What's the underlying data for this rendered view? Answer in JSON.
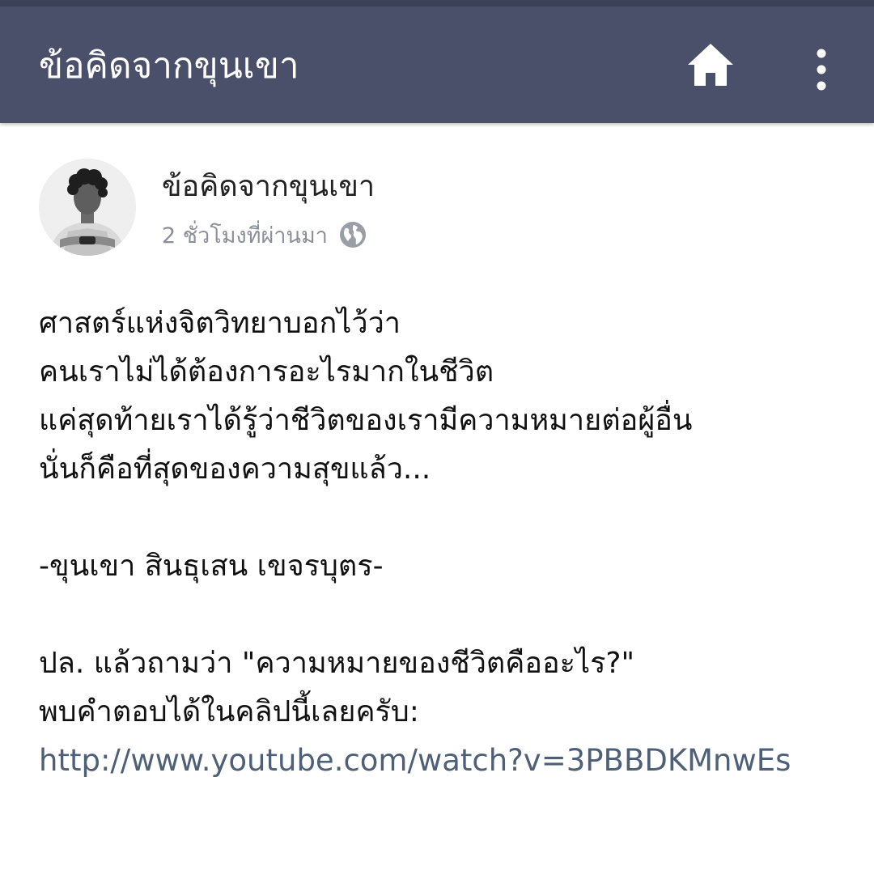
{
  "app_bar": {
    "title": "ข้อคิดจากขุนเขา",
    "home_icon": "home-icon",
    "more_icon": "more-vertical-icon",
    "background_color": "#4a5069"
  },
  "post": {
    "author": "ข้อคิดจากขุนเขา",
    "time": "2 ชั่วโมงที่ผ่านมา",
    "privacy_icon": "globe-icon",
    "lines": [
      "ศาสตร์แห่งจิตวิทยาบอกไว้ว่า",
      "คนเราไม่ได้ต้องการอะไรมากในชีวิต",
      "แค่สุดท้ายเราได้รู้ว่าชีวิตของเรามีความหมายต่อผู้อื่น",
      "นั่นก็คือที่สุดของความสุขแล้ว...",
      "",
      "-ขุนเขา สินธุเสน เขจรบุตร-",
      "",
      "ปล. แล้วถามว่า \"ความหมายของชีวิตคืออะไร?\"",
      "พบคำตอบได้ในคลิปนี้เลยครับ:"
    ],
    "link": "http://www.youtube.com/watch?v=3PBBDKMnwEs",
    "link_color": "#4e6077"
  }
}
